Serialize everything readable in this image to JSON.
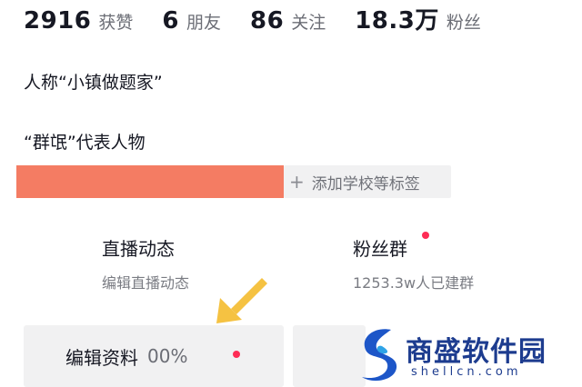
{
  "stats": [
    {
      "value": "2916",
      "label": "获赞"
    },
    {
      "value": "6",
      "label": "朋友"
    },
    {
      "value": "86",
      "label": "关注"
    },
    {
      "value": "18.3万",
      "label": "粉丝"
    }
  ],
  "bio": {
    "line1": "人称“小镇做题家”",
    "line2": "“群氓”代表人物"
  },
  "add_school": {
    "icon": "plus-icon",
    "label": "添加学校等标签"
  },
  "cards": {
    "live": {
      "title": "直播动态",
      "subtitle": "编辑直播动态"
    },
    "fans": {
      "title": "粉丝群",
      "subtitle": "1253.3w人已建群"
    }
  },
  "edit_profile": {
    "label": "编辑资料",
    "progress": "00%"
  },
  "annotation": {
    "icon": "arrow-icon",
    "color": "#f5c242"
  },
  "watermark": {
    "name": "商盛软件园",
    "url": "shellcn.com"
  },
  "colors": {
    "accent_dot": "#fe2c55",
    "redaction": "#f47c63"
  }
}
